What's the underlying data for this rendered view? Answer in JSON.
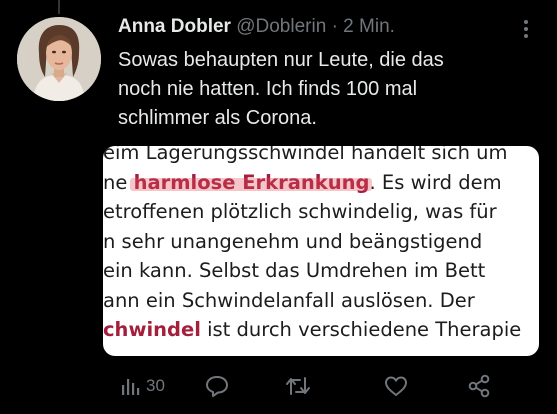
{
  "tweet": {
    "author_name": "Anna Dobler",
    "handle": "@Doblerin",
    "separator": "·",
    "timestamp": "2 Min.",
    "text_lines": [
      "Sowas behaupten nur Leute, die das",
      "noch nie hatten. Ich finds 100 mal",
      "schlimmer als Corona."
    ]
  },
  "media": {
    "lines": [
      {
        "before": "eim Lagerungsschwindel handelt sich um",
        "highlight": "",
        "after": ""
      },
      {
        "before": "ne ",
        "highlight": "harmlose Erkrankung",
        "after": ". Es wird dem"
      },
      {
        "before": "etroffenen plötzlich schwindelig, was für",
        "highlight": "",
        "after": ""
      },
      {
        "before": "n sehr unangenehm und beängstigend",
        "highlight": "",
        "after": ""
      },
      {
        "before": "ein kann. Selbst das Umdrehen im Bett",
        "highlight": "",
        "after": ""
      },
      {
        "before": "ann ein Schwindelanfall auslösen. Der",
        "highlight": "",
        "after": ""
      },
      {
        "before": "",
        "highlight": "chwindel",
        "after": " ist durch verschiedene Therapie"
      }
    ]
  },
  "actions": {
    "views_count": "30",
    "icons": [
      "views-icon",
      "reply-icon",
      "retweet-icon",
      "like-icon",
      "share-icon"
    ]
  },
  "colors": {
    "background": "#000000",
    "text": "#e7e9ea",
    "muted": "#71767b",
    "highlight": "#a41f3c"
  }
}
